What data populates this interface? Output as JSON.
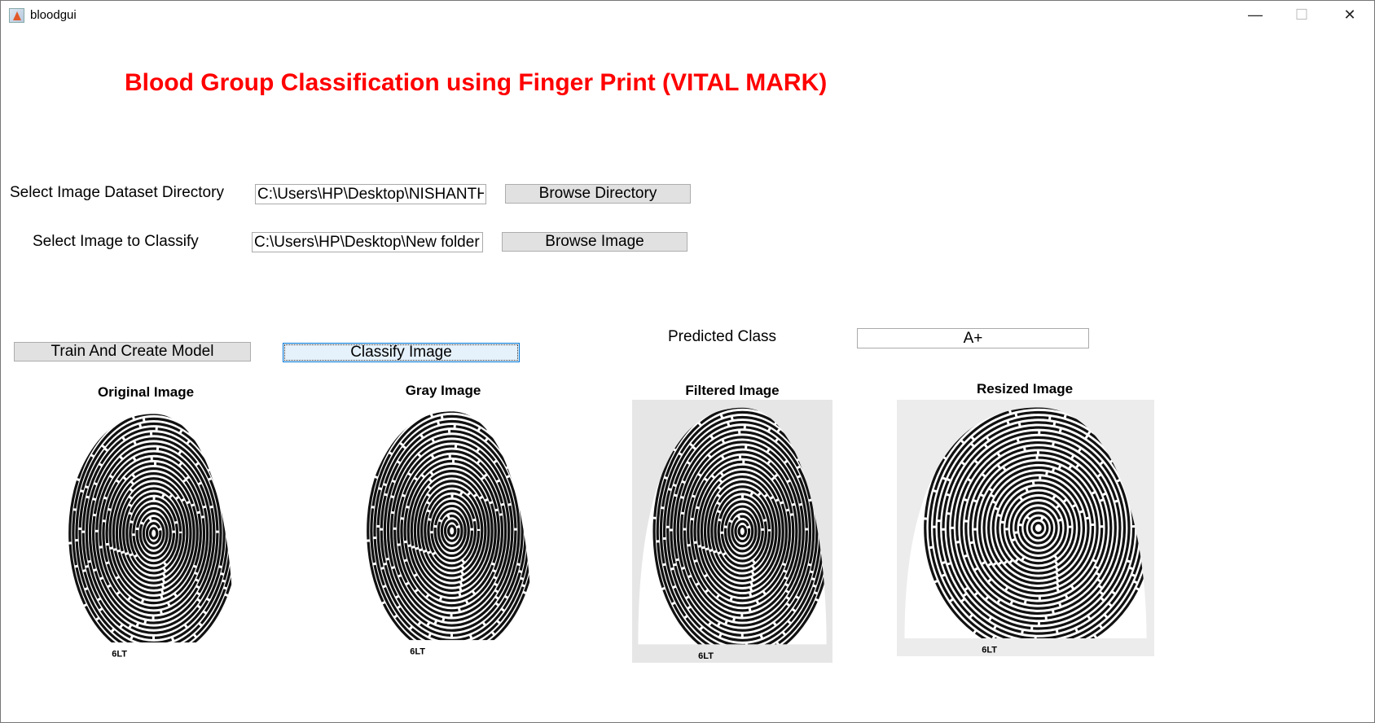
{
  "window": {
    "title": "bloodgui",
    "minimize": "—",
    "maximize": "☐",
    "close": "✕"
  },
  "heading": "Blood Group Classification using Finger Print (VITAL MARK)",
  "dataset": {
    "label": "Select Image Dataset Directory",
    "value": "C:\\Users\\HP\\Desktop\\NISHANTH",
    "button": "Browse Directory"
  },
  "image": {
    "label": "Select Image to Classify",
    "value": "C:\\Users\\HP\\Desktop\\New folder",
    "button": "Browse Image"
  },
  "train_button": "Train And Create Model",
  "classify_button": "Classify Image",
  "predicted": {
    "label": "Predicted Class",
    "value": "A+"
  },
  "panels": [
    {
      "title": "Original Image",
      "caption": "6LT"
    },
    {
      "title": "Gray Image",
      "caption": "6LT"
    },
    {
      "title": "Filtered Image",
      "caption": "6LT"
    },
    {
      "title": "Resized Image",
      "caption": "6LT"
    }
  ],
  "colors": {
    "heading": "#ff0000",
    "focus_button": "#e5f1fb",
    "focus_border": "#0078d7"
  }
}
